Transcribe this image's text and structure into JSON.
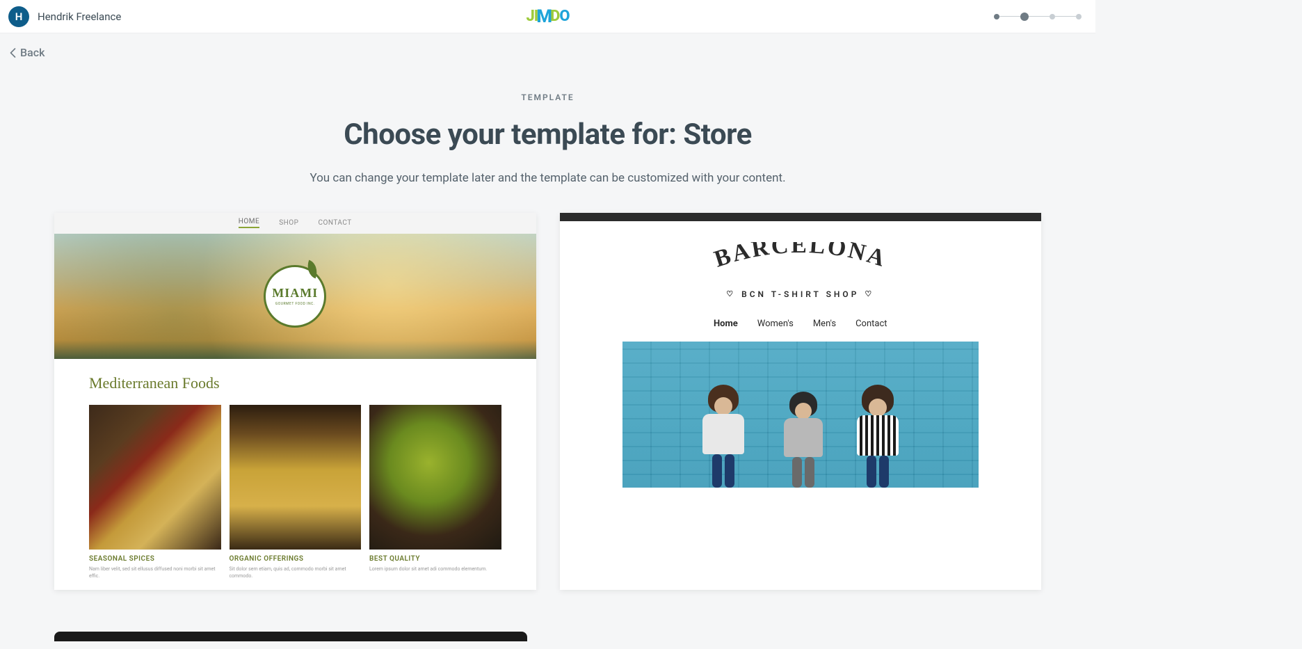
{
  "header": {
    "avatar_initial": "H",
    "username": "Hendrik Freelance",
    "logo_parts": {
      "j": "J",
      "i": "I",
      "m": "M",
      "d": "D",
      "o": "O"
    }
  },
  "back": {
    "label": "Back"
  },
  "hero": {
    "eyebrow": "TEMPLATE",
    "title": "Choose your template for: Store",
    "subtitle": "You can change your template later and the template can be customized with your content."
  },
  "templates": {
    "miami": {
      "nav": {
        "home": "HOME",
        "shop": "SHOP",
        "contact": "CONTACT"
      },
      "badge": {
        "name": "MIAMI",
        "sub": "GOURMET FOOD INC."
      },
      "heading": "Mediterranean Foods",
      "cols": [
        {
          "title": "SEASONAL SPICES",
          "text": "Nam liber velit, sed sit ellusus diffused noni morbi sit amet effic."
        },
        {
          "title": "ORGANIC OFFERINGS",
          "text": "Sit dolor sem etiam, quis ad, commodo morbi sit amet commodo."
        },
        {
          "title": "BEST QUALITY",
          "text": "Lorem ipsum dolor sit amet adi commodo elementum."
        }
      ]
    },
    "barcelona": {
      "logo": "BARCELONA",
      "tagline": "BCN T-SHIRT SHOP",
      "nav": {
        "home": "Home",
        "womens": "Women's",
        "mens": "Men's",
        "contact": "Contact"
      }
    }
  }
}
